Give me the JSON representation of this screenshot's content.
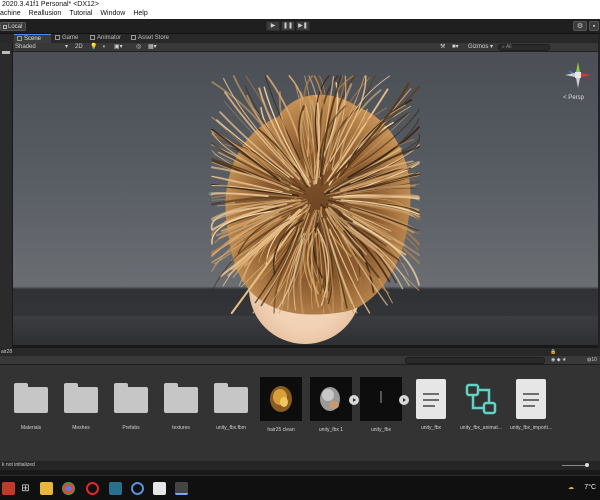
{
  "window": {
    "title": "2020.3.41f1 Personal* <DX12>"
  },
  "menu": [
    "achine",
    "Reallusion",
    "Tutorial",
    "Window",
    "Help"
  ],
  "toolbar": {
    "pivot_label": "Local",
    "play": "▶",
    "pause": "❚❚",
    "step": "▶❚"
  },
  "tabs": [
    {
      "label": "Scene",
      "active": true
    },
    {
      "label": "Game",
      "active": false
    },
    {
      "label": "Animator",
      "active": false
    },
    {
      "label": "Asset Store",
      "active": false
    }
  ],
  "scene_toolbar": {
    "shading": "Shaded",
    "mode_2d": "2D",
    "gizmos": "Gizmos",
    "search_placeholder": "All"
  },
  "viewport": {
    "projection_label": "< Persp"
  },
  "project": {
    "breadcrumb": "air28",
    "item_count": "10",
    "assets": [
      {
        "name": "Materials",
        "type": "folder"
      },
      {
        "name": "Meshes",
        "type": "folder"
      },
      {
        "name": "Prefabs",
        "type": "folder"
      },
      {
        "name": "textures",
        "type": "folder"
      },
      {
        "name": "unity_fbx.fbm",
        "type": "folder"
      },
      {
        "name": "hair25 clean",
        "type": "model-hair"
      },
      {
        "name": "unity_fbx 1",
        "type": "model-head"
      },
      {
        "name": "unity_fbx",
        "type": "model-dark"
      },
      {
        "name": "unity_fbx",
        "type": "document"
      },
      {
        "name": "unity_fbx_animat...",
        "type": "animator"
      },
      {
        "name": "unity_fbx_importi...",
        "type": "document"
      }
    ]
  },
  "status": {
    "message": "k not initialized"
  },
  "taskbar": {
    "weather": "7°C"
  },
  "colors": {
    "tab_accent": "#4c8bf5",
    "hair_light": "#d9a86a",
    "hair_dark": "#3a2614",
    "animator_accent": "#5fd3c4"
  }
}
